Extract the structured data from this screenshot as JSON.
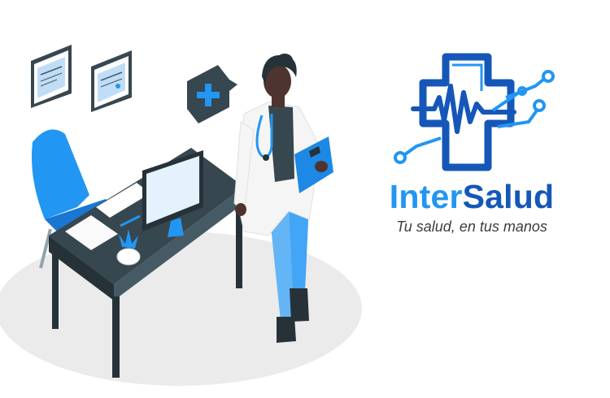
{
  "brand": {
    "name_part1": "Inter",
    "name_part2": "Salud",
    "tagline": "Tu salud, en tus manos"
  },
  "icons": [
    "medical-cross-logo-icon",
    "heartbeat-icon",
    "circuit-node-icon",
    "stethoscope-icon",
    "clipboard-icon",
    "medical-cross-sign-icon",
    "plant-icon",
    "monitor-icon"
  ],
  "colors": {
    "brand_light_blue": "#2196f3",
    "brand_dark_blue": "#1557b8",
    "tagline_gray": "#3c3c3c",
    "desk_dark": "#37474f",
    "chair_blue": "#2196f3",
    "floor_gray": "#ebebeb"
  }
}
